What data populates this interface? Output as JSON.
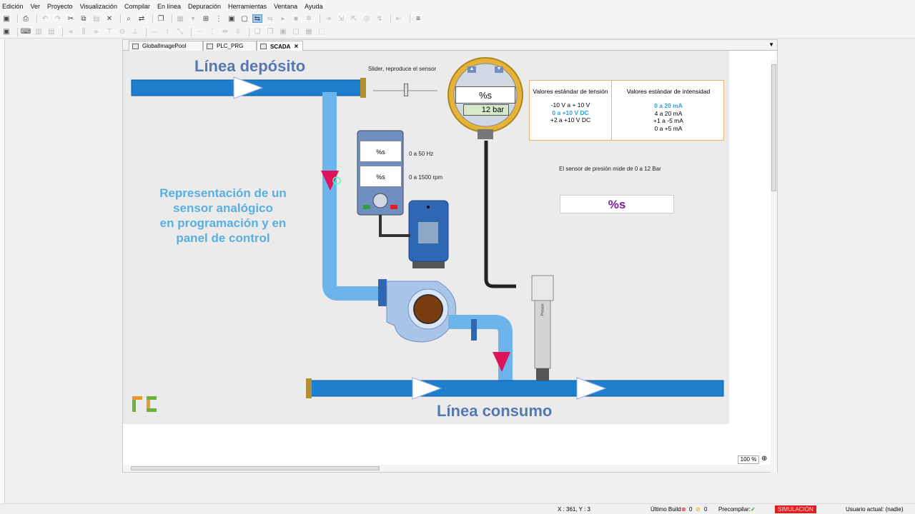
{
  "menu": [
    "Edición",
    "Ver",
    "Proyecto",
    "Visualización",
    "Compilar",
    "En línea",
    "Depuración",
    "Herramientas",
    "Ventana",
    "Ayuda"
  ],
  "tabs": [
    {
      "label": "GlobalImagePool",
      "active": false
    },
    {
      "label": "PLC_PRG",
      "active": false
    },
    {
      "label": "SCADA",
      "active": true
    }
  ],
  "scada": {
    "linea_deposito": "Línea depósito",
    "linea_consumo": "Línea consumo",
    "slider_label": "Slider, reproduce el sensor",
    "description_lines": [
      "Representación de un",
      "sensor analógico",
      "en programación y en",
      "panel de control"
    ],
    "vfd": {
      "display1": "%s",
      "display2": "%s",
      "label1": "0 a 50 Hz",
      "label2": "0 a 1500 rpm"
    },
    "gauge": {
      "display": "%s",
      "bar_value": "12 bar"
    },
    "table": {
      "col1_header": "Valores estándar de tensión",
      "col1_rows": [
        "-10 V a + 10 V",
        "0 a +10 V DC",
        "+2 a +10 V DC"
      ],
      "col1_highlight": 1,
      "col2_header": "Valores estándar de intensidad",
      "col2_rows": [
        "0 a 20 mA",
        "4 a 20 mA",
        "+1 a -5 mA",
        "0 a +5 mA"
      ],
      "col2_highlight": 0
    },
    "pressure_caption": "El sensor de presión mide de 0 a 12 Bar",
    "pressure_display": "%s",
    "sensor_label": "Presión",
    "colors": {
      "pipe_dark": "#1e7fcf",
      "pipe_light": "#6cb4ea",
      "marker": "#e0135a",
      "title": "#5677b0",
      "note": "#5aaee0"
    }
  },
  "zoom": "100 %",
  "status": {
    "coords": "X : 361, Y : 3",
    "last_build_label": "Último Build",
    "errors": "0",
    "warnings": "0",
    "precompile_label": "Precompilar:",
    "simulation": "SIMULACIÓN",
    "user": "Usuario actual: (nadie)"
  }
}
